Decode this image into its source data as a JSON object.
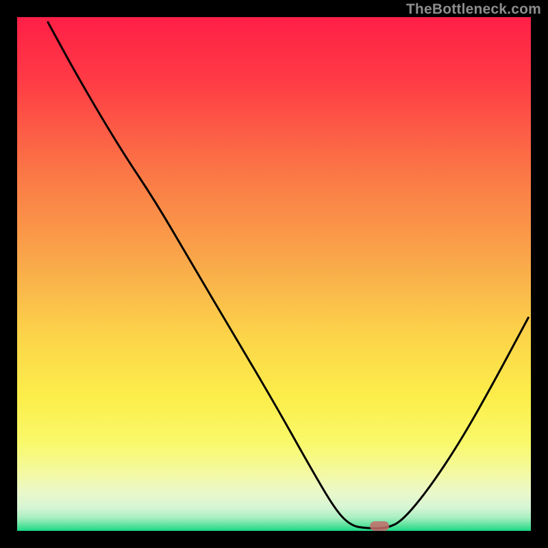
{
  "watermark": "TheBottleneck.com",
  "colors": {
    "curve_stroke": "#000000",
    "marker_fill": "#c66b6b"
  },
  "chart_data": {
    "type": "line",
    "title": "",
    "xlabel": "",
    "ylabel": "",
    "xlim": [
      0,
      100
    ],
    "ylim": [
      0,
      100
    ],
    "gradient_stops": [
      {
        "offset": 0.0,
        "color": "#ff1f47"
      },
      {
        "offset": 0.12,
        "color": "#ff3a45"
      },
      {
        "offset": 0.3,
        "color": "#fb7646"
      },
      {
        "offset": 0.48,
        "color": "#f9a94a"
      },
      {
        "offset": 0.62,
        "color": "#fcd449"
      },
      {
        "offset": 0.74,
        "color": "#fcee4a"
      },
      {
        "offset": 0.83,
        "color": "#f9f96b"
      },
      {
        "offset": 0.89,
        "color": "#f3f9a4"
      },
      {
        "offset": 0.925,
        "color": "#eaf8ca"
      },
      {
        "offset": 0.955,
        "color": "#d6f5d4"
      },
      {
        "offset": 0.975,
        "color": "#a6eec0"
      },
      {
        "offset": 0.99,
        "color": "#55e19a"
      },
      {
        "offset": 1.0,
        "color": "#18d985"
      }
    ],
    "curve_points": [
      {
        "x": 6.0,
        "y": 99.0
      },
      {
        "x": 12.0,
        "y": 88.0
      },
      {
        "x": 20.0,
        "y": 74.5
      },
      {
        "x": 27.0,
        "y": 64.0
      },
      {
        "x": 34.0,
        "y": 52.0
      },
      {
        "x": 42.0,
        "y": 38.5
      },
      {
        "x": 50.0,
        "y": 25.0
      },
      {
        "x": 57.0,
        "y": 12.5
      },
      {
        "x": 62.0,
        "y": 4.0
      },
      {
        "x": 65.0,
        "y": 1.0
      },
      {
        "x": 68.0,
        "y": 0.5
      },
      {
        "x": 72.0,
        "y": 0.5
      },
      {
        "x": 75.0,
        "y": 2.0
      },
      {
        "x": 80.0,
        "y": 8.0
      },
      {
        "x": 86.0,
        "y": 17.0
      },
      {
        "x": 92.0,
        "y": 27.5
      },
      {
        "x": 99.5,
        "y": 41.5
      }
    ],
    "marker": {
      "x": 70.5,
      "y": 0.9
    }
  }
}
